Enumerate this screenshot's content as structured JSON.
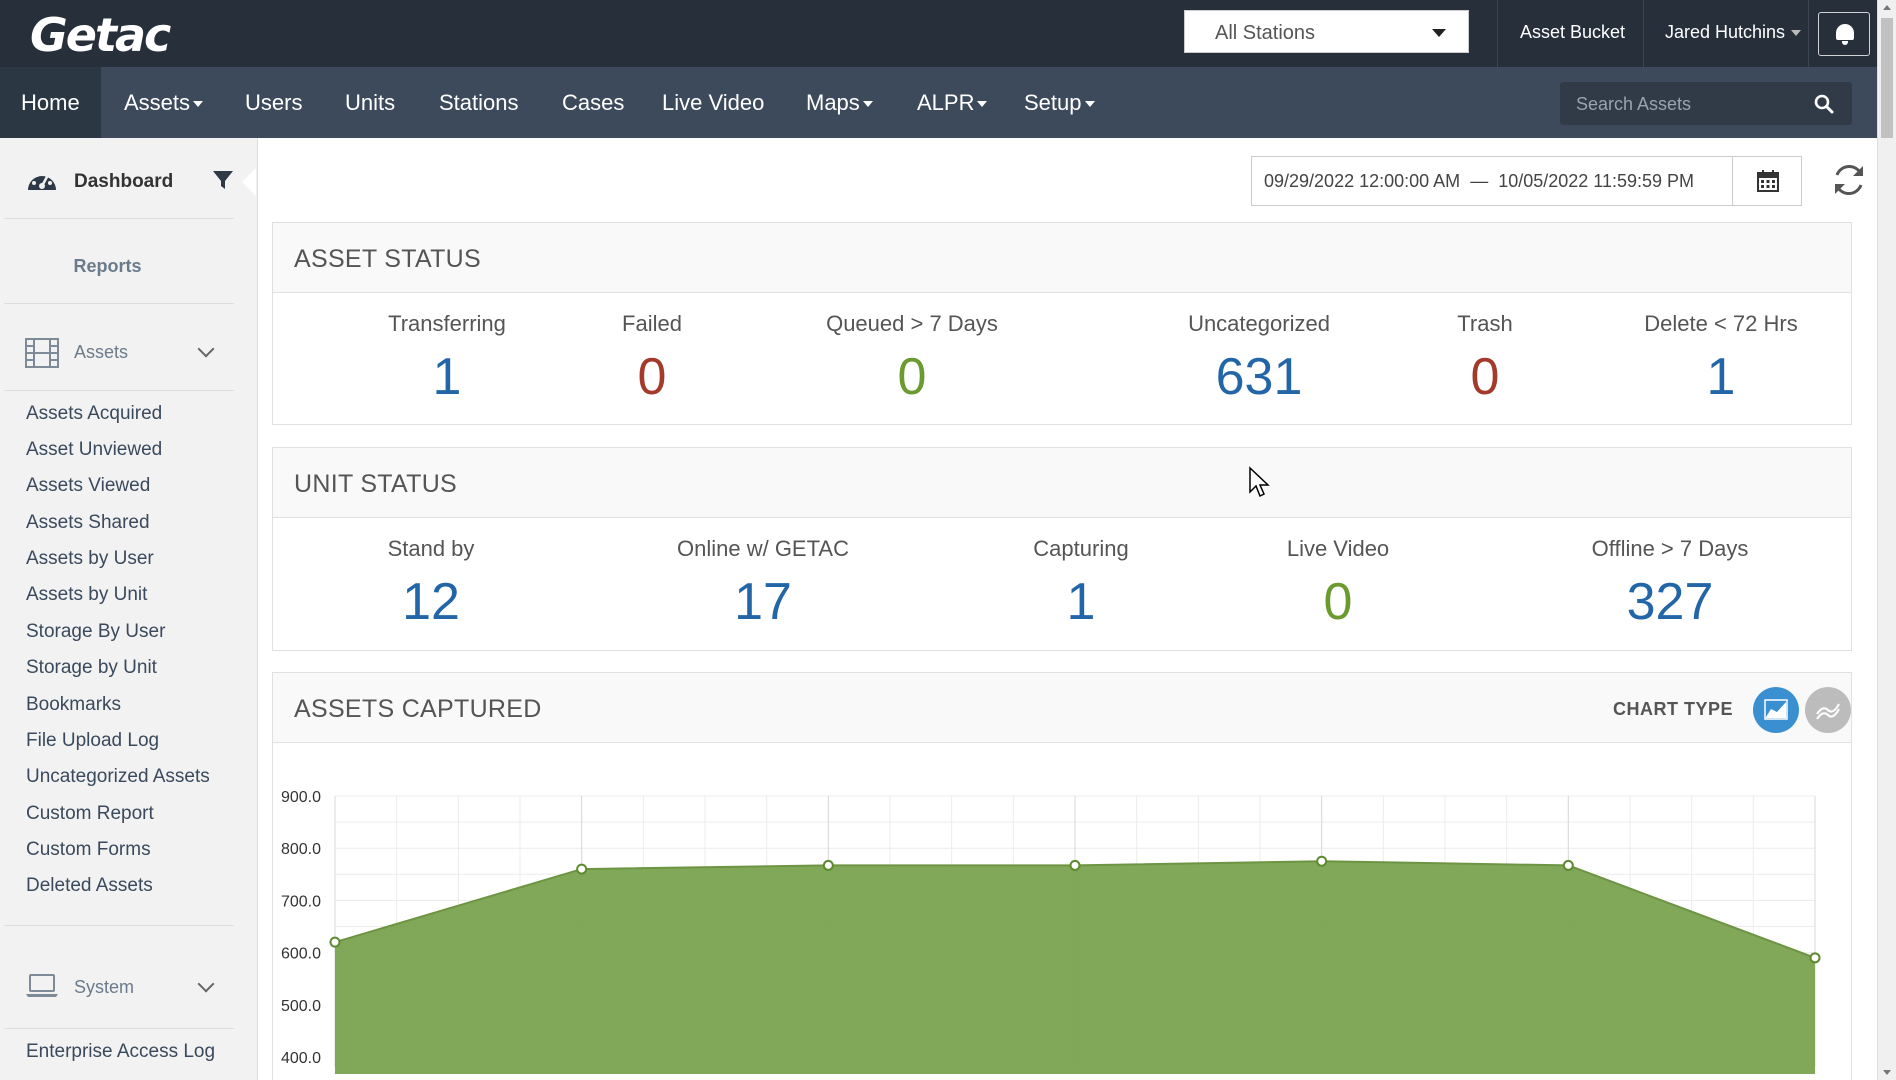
{
  "app": {
    "logo": "Getac"
  },
  "header": {
    "station_select": "All Stations",
    "asset_bucket": "Asset Bucket",
    "user_name": "Jared Hutchins"
  },
  "nav": {
    "items": [
      {
        "label": "Home",
        "dropdown": false,
        "active": true
      },
      {
        "label": "Assets",
        "dropdown": true
      },
      {
        "label": "Users",
        "dropdown": false
      },
      {
        "label": "Units",
        "dropdown": false
      },
      {
        "label": "Stations",
        "dropdown": false
      },
      {
        "label": "Cases",
        "dropdown": false
      },
      {
        "label": "Live Video",
        "dropdown": false
      },
      {
        "label": "Maps",
        "dropdown": true
      },
      {
        "label": "ALPR",
        "dropdown": true
      },
      {
        "label": "Setup",
        "dropdown": true
      }
    ],
    "search_placeholder": "Search Assets"
  },
  "sidebar": {
    "dashboard_label": "Dashboard",
    "reports_label": "Reports",
    "assets_group": {
      "label": "Assets",
      "items": [
        "Assets Acquired",
        "Asset Unviewed",
        "Assets Viewed",
        "Assets Shared",
        "Assets by User",
        "Assets by Unit",
        "Storage By User",
        "Storage by Unit",
        "Bookmarks",
        "File Upload Log",
        "Uncategorized Assets",
        "Custom Report",
        "Custom Forms",
        "Deleted Assets"
      ]
    },
    "system_group": {
      "label": "System",
      "items": [
        "Enterprise Access Log"
      ]
    }
  },
  "date_range": {
    "start": "09/29/2022 12:00:00 AM",
    "separator": "—",
    "end": "10/05/2022 11:59:59 PM"
  },
  "asset_status": {
    "title": "ASSET STATUS",
    "stats": [
      {
        "label": "Transferring",
        "value": "1",
        "color": "#2366a8"
      },
      {
        "label": "Failed",
        "value": "0",
        "color": "#a33a2c"
      },
      {
        "label": "Queued > 7 Days",
        "value": "0",
        "color": "#6b9a2e"
      },
      {
        "label": "Uncategorized",
        "value": "631",
        "color": "#2366a8"
      },
      {
        "label": "Trash",
        "value": "0",
        "color": "#a33a2c"
      },
      {
        "label": "Delete < 72 Hrs",
        "value": "1",
        "color": "#2366a8"
      }
    ]
  },
  "unit_status": {
    "title": "UNIT STATUS",
    "stats": [
      {
        "label": "Stand by",
        "value": "12",
        "color": "#2366a8"
      },
      {
        "label": "Online w/ GETAC",
        "value": "17",
        "color": "#2366a8"
      },
      {
        "label": "Capturing",
        "value": "1",
        "color": "#2366a8"
      },
      {
        "label": "Live Video",
        "value": "0",
        "color": "#6b9a2e"
      },
      {
        "label": "Offline > 7 Days",
        "value": "327",
        "color": "#2366a8"
      }
    ]
  },
  "assets_captured": {
    "title": "ASSETS CAPTURED",
    "chart_type_label": "CHART TYPE"
  },
  "chart_data": {
    "type": "area",
    "title": "",
    "xlabel": "",
    "ylabel": "",
    "x": [
      0,
      1,
      2,
      3,
      4,
      5,
      6
    ],
    "values": [
      620,
      760,
      767,
      767,
      775,
      767,
      590
    ],
    "yticks": [
      "900.0",
      "800.0",
      "700.0",
      "600.0",
      "500.0",
      "400.0"
    ],
    "ylim": [
      400,
      900
    ],
    "color": "#7aa34f",
    "grid": true
  }
}
